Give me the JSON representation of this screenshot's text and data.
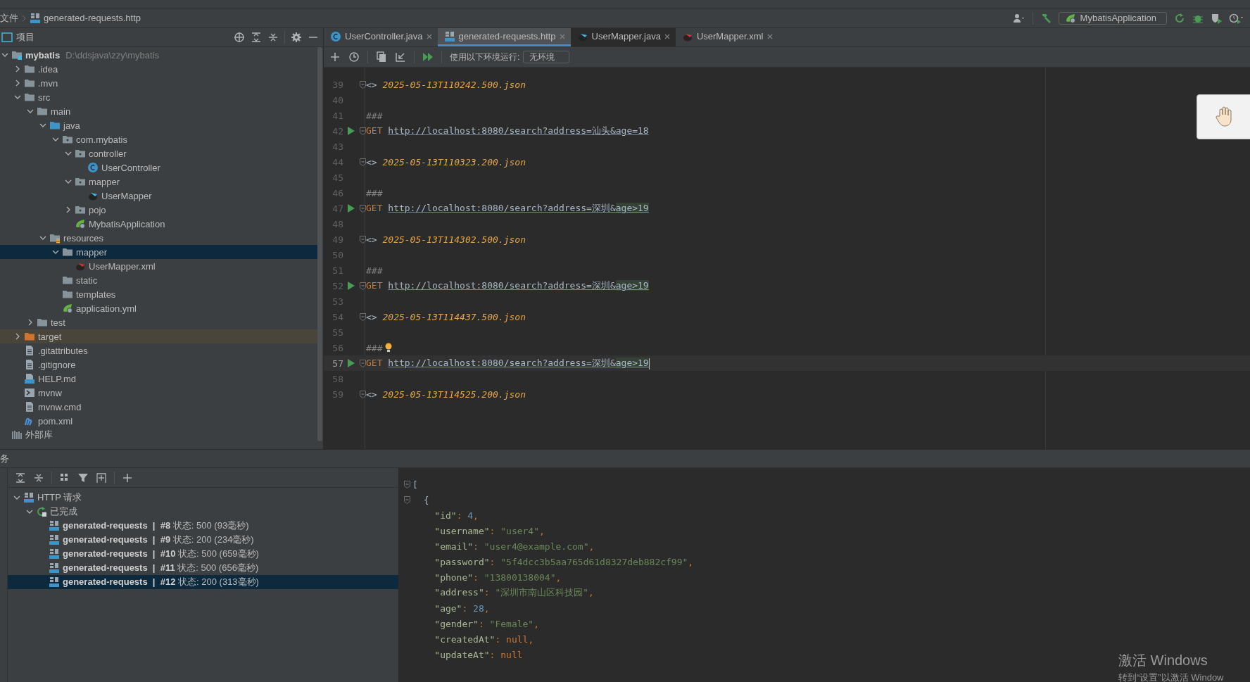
{
  "breadcrumb": [
    "文件",
    "generated-requests.http"
  ],
  "run_config": {
    "label": "MybatisApplication"
  },
  "project_panel": {
    "title": "项目",
    "tree": [
      {
        "label": "mybatis",
        "path": "D:\\ddsjava\\zzy\\mybatis",
        "kind": "module",
        "expanded": true,
        "selected": false,
        "children": [
          {
            "label": ".idea",
            "kind": "folder",
            "expanded": false,
            "selected": false
          },
          {
            "label": ".mvn",
            "kind": "folder",
            "expanded": false,
            "selected": false
          },
          {
            "label": "src",
            "kind": "folder",
            "expanded": true,
            "selected": false,
            "children": [
              {
                "label": "main",
                "kind": "folder",
                "expanded": true,
                "selected": false,
                "children": [
                  {
                    "label": "java",
                    "kind": "source_folder",
                    "expanded": true,
                    "selected": false,
                    "children": [
                      {
                        "label": "com.mybatis",
                        "kind": "package",
                        "expanded": true,
                        "selected": false,
                        "children": [
                          {
                            "label": "controller",
                            "kind": "package",
                            "expanded": true,
                            "selected": false,
                            "children": [
                              {
                                "label": "UserController",
                                "kind": "class",
                                "selected": false
                              }
                            ]
                          },
                          {
                            "label": "mapper",
                            "kind": "package",
                            "expanded": true,
                            "selected": false,
                            "children": [
                              {
                                "label": "UserMapper",
                                "kind": "mapper",
                                "selected": false
                              }
                            ]
                          },
                          {
                            "label": "pojo",
                            "kind": "package",
                            "expanded": false,
                            "selected": false
                          },
                          {
                            "label": "MybatisApplication",
                            "kind": "spring",
                            "selected": false
                          }
                        ]
                      }
                    ]
                  },
                  {
                    "label": "resources",
                    "kind": "resources",
                    "expanded": true,
                    "selected": false,
                    "children": [
                      {
                        "label": "mapper",
                        "kind": "folder",
                        "expanded": true,
                        "selected": true,
                        "children": [
                          {
                            "label": "UserMapper.xml",
                            "kind": "mapper_xml",
                            "selected": false
                          }
                        ]
                      },
                      {
                        "label": "static",
                        "kind": "folder",
                        "selected": false
                      },
                      {
                        "label": "templates",
                        "kind": "folder",
                        "selected": false
                      },
                      {
                        "label": "application.yml",
                        "kind": "spring",
                        "selected": false
                      }
                    ]
                  }
                ]
              },
              {
                "label": "test",
                "kind": "folder",
                "expanded": false,
                "selected": false
              }
            ]
          },
          {
            "label": "target",
            "kind": "excluded",
            "expanded": false,
            "selected": false
          },
          {
            "label": ".gitattributes",
            "kind": "file",
            "selected": false
          },
          {
            "label": ".gitignore",
            "kind": "file",
            "selected": false
          },
          {
            "label": "HELP.md",
            "kind": "md",
            "selected": false
          },
          {
            "label": "mvnw",
            "kind": "script",
            "selected": false
          },
          {
            "label": "mvnw.cmd",
            "kind": "file",
            "selected": false
          },
          {
            "label": "pom.xml",
            "kind": "maven",
            "selected": false
          }
        ]
      },
      {
        "label": "外部库",
        "kind": "library",
        "selected": false
      }
    ]
  },
  "editor_tabs": [
    {
      "label": "UserController.java",
      "kind": "class",
      "selected": false
    },
    {
      "label": "generated-requests.http",
      "kind": "api",
      "selected": true
    },
    {
      "label": "UserMapper.java",
      "kind": "mapper",
      "selected": false
    },
    {
      "label": "UserMapper.xml",
      "kind": "mapper_xml",
      "selected": false
    }
  ],
  "editor_toolbar": {
    "env_label": "使用以下环境运行:",
    "env_value": "无环境"
  },
  "editor": {
    "lines": [
      {
        "number": "39",
        "kind": "response",
        "current": false,
        "tokens": [
          {
            "t": "<> ",
            "kind": "plain"
          },
          {
            "t": "2025-05-13T110242.500.json",
            "kind": "file"
          }
        ]
      },
      {
        "number": "40",
        "kind": "blank",
        "current": false
      },
      {
        "number": "41",
        "kind": "separator",
        "current": false,
        "tokens": [
          {
            "t": "###",
            "kind": "comment"
          }
        ]
      },
      {
        "number": "42",
        "kind": "request",
        "current": false,
        "tokens": [
          {
            "t": "GET ",
            "kind": "method"
          },
          {
            "t": "http://localhost:8080/search?address=汕头&age=18",
            "kind": "url"
          }
        ]
      },
      {
        "number": "43",
        "kind": "blank",
        "current": false
      },
      {
        "number": "44",
        "kind": "response",
        "current": false,
        "tokens": [
          {
            "t": "<> ",
            "kind": "plain"
          },
          {
            "t": "2025-05-13T110323.200.json",
            "kind": "file"
          }
        ]
      },
      {
        "number": "45",
        "kind": "blank",
        "current": false
      },
      {
        "number": "46",
        "kind": "separator",
        "current": false,
        "tokens": [
          {
            "t": "###",
            "kind": "comment"
          }
        ]
      },
      {
        "number": "47",
        "kind": "request",
        "current": false,
        "tokens": [
          {
            "t": "GET ",
            "kind": "method"
          },
          {
            "t": "http://localhost:8080/search?address=深圳&",
            "kind": "url"
          },
          {
            "t": "age>19",
            "kind": "url_flagged"
          }
        ]
      },
      {
        "number": "48",
        "kind": "blank",
        "current": false
      },
      {
        "number": "49",
        "kind": "response",
        "current": false,
        "tokens": [
          {
            "t": "<> ",
            "kind": "plain"
          },
          {
            "t": "2025-05-13T114302.500.json",
            "kind": "file"
          }
        ]
      },
      {
        "number": "50",
        "kind": "blank",
        "current": false
      },
      {
        "number": "51",
        "kind": "separator",
        "current": false,
        "tokens": [
          {
            "t": "###",
            "kind": "comment"
          }
        ]
      },
      {
        "number": "52",
        "kind": "request",
        "current": false,
        "tokens": [
          {
            "t": "GET ",
            "kind": "method"
          },
          {
            "t": "http://localhost:8080/search?address=深圳&",
            "kind": "url"
          },
          {
            "t": "age>19",
            "kind": "url_flagged"
          }
        ]
      },
      {
        "number": "53",
        "kind": "blank",
        "current": false
      },
      {
        "number": "54",
        "kind": "response",
        "current": false,
        "tokens": [
          {
            "t": "<> ",
            "kind": "plain"
          },
          {
            "t": "2025-05-13T114437.500.json",
            "kind": "file"
          }
        ]
      },
      {
        "number": "55",
        "kind": "blank",
        "current": false
      },
      {
        "number": "56",
        "kind": "separator",
        "current": false,
        "intention": true,
        "tokens": [
          {
            "t": "###",
            "kind": "comment"
          }
        ]
      },
      {
        "number": "57",
        "kind": "request",
        "current": true,
        "tokens": [
          {
            "t": "GET ",
            "kind": "method"
          },
          {
            "t": "http://localhost:8080/search?address=深圳&",
            "kind": "url"
          },
          {
            "t": "age>19",
            "kind": "url_flagged"
          }
        ]
      },
      {
        "number": "58",
        "kind": "blank",
        "current": false
      },
      {
        "number": "59",
        "kind": "response",
        "current": false,
        "tokens": [
          {
            "t": "<> ",
            "kind": "plain"
          },
          {
            "t": "2025-05-13T114525.200.json",
            "kind": "file"
          }
        ]
      }
    ]
  },
  "bottom_panel": {
    "title": "务",
    "tree": [
      {
        "label": "HTTP 请求",
        "kind": "api",
        "expanded": true,
        "selected": false,
        "children": [
          {
            "label": "已完成",
            "kind": "done",
            "expanded": true,
            "selected": false,
            "children": [
              {
                "label": "**generated-requests  |  #8** 状态: 500 (93毫秒)",
                "kind": "api",
                "selected": false
              },
              {
                "label": "**generated-requests  |  #9** 状态: 200 (234毫秒)",
                "kind": "api",
                "selected": false
              },
              {
                "label": "**generated-requests  |  #10** 状态: 500 (659毫秒)",
                "kind": "api",
                "selected": false
              },
              {
                "label": "**generated-requests  |  #11** 状态: 500 (656毫秒)",
                "kind": "api",
                "selected": false
              },
              {
                "label": "**generated-requests  |  #12** 状态: 200 (313毫秒)",
                "kind": "api",
                "selected": true
              }
            ]
          }
        ]
      }
    ]
  },
  "response": {
    "lines": [
      {
        "fold": true,
        "tokens": [
          {
            "t": "[",
            "kind": "plain"
          }
        ]
      },
      {
        "fold": true,
        "tokens": [
          {
            "t": "  {",
            "kind": "plain"
          }
        ]
      },
      {
        "fold": false,
        "tokens": [
          {
            "t": "    \"id\"",
            "kind": "key"
          },
          {
            "t": ": ",
            "kind": "punct"
          },
          {
            "t": "4",
            "kind": "number"
          },
          {
            "t": ",",
            "kind": "punct"
          }
        ]
      },
      {
        "fold": false,
        "tokens": [
          {
            "t": "    \"username\"",
            "kind": "key"
          },
          {
            "t": ": ",
            "kind": "punct"
          },
          {
            "t": "\"user4\"",
            "kind": "string"
          },
          {
            "t": ",",
            "kind": "punct"
          }
        ]
      },
      {
        "fold": false,
        "tokens": [
          {
            "t": "    \"email\"",
            "kind": "key"
          },
          {
            "t": ": ",
            "kind": "punct"
          },
          {
            "t": "\"user4@example.com\"",
            "kind": "string"
          },
          {
            "t": ",",
            "kind": "punct"
          }
        ]
      },
      {
        "fold": false,
        "tokens": [
          {
            "t": "    \"password\"",
            "kind": "key"
          },
          {
            "t": ": ",
            "kind": "punct"
          },
          {
            "t": "\"5f4dcc3b5aa765d61d8327deb882cf99\"",
            "kind": "string"
          },
          {
            "t": ",",
            "kind": "punct"
          }
        ]
      },
      {
        "fold": false,
        "tokens": [
          {
            "t": "    \"phone\"",
            "kind": "key"
          },
          {
            "t": ": ",
            "kind": "punct"
          },
          {
            "t": "\"13800138004\"",
            "kind": "string"
          },
          {
            "t": ",",
            "kind": "punct"
          }
        ]
      },
      {
        "fold": false,
        "tokens": [
          {
            "t": "    \"address\"",
            "kind": "key"
          },
          {
            "t": ": ",
            "kind": "punct"
          },
          {
            "t": "\"深圳市南山区科技园\"",
            "kind": "string"
          },
          {
            "t": ",",
            "kind": "punct"
          }
        ]
      },
      {
        "fold": false,
        "tokens": [
          {
            "t": "    \"age\"",
            "kind": "key"
          },
          {
            "t": ": ",
            "kind": "punct"
          },
          {
            "t": "28",
            "kind": "number"
          },
          {
            "t": ",",
            "kind": "punct"
          }
        ]
      },
      {
        "fold": false,
        "tokens": [
          {
            "t": "    \"gender\"",
            "kind": "key"
          },
          {
            "t": ": ",
            "kind": "punct"
          },
          {
            "t": "\"Female\"",
            "kind": "string"
          },
          {
            "t": ",",
            "kind": "punct"
          }
        ]
      },
      {
        "fold": false,
        "tokens": [
          {
            "t": "    \"createdAt\"",
            "kind": "key"
          },
          {
            "t": ": ",
            "kind": "punct"
          },
          {
            "t": "null",
            "kind": "null"
          },
          {
            "t": ",",
            "kind": "punct"
          }
        ]
      },
      {
        "fold": false,
        "tokens": [
          {
            "t": "    \"updateAt\"",
            "kind": "key"
          },
          {
            "t": ": ",
            "kind": "punct"
          },
          {
            "t": "null",
            "kind": "null"
          }
        ]
      }
    ]
  },
  "os_notice": {
    "title": "激活 Windows",
    "subtitle": "转到“设置”以激活 Window"
  }
}
